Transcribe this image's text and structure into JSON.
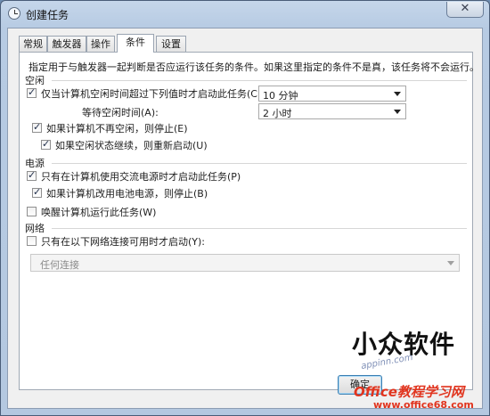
{
  "window": {
    "title": "创建任务",
    "close_glyph": "✕"
  },
  "tabs": [
    {
      "label": "常规",
      "active": false
    },
    {
      "label": "触发器",
      "active": false
    },
    {
      "label": "操作",
      "active": false
    },
    {
      "label": "条件",
      "active": true
    },
    {
      "label": "设置",
      "active": false
    }
  ],
  "conditions": {
    "description": "指定用于与触发器一起判断是否应运行该任务的条件。如果这里指定的条件不是真，该任务将不会运行。",
    "idle": {
      "heading": "空闲",
      "start_if_idle": {
        "label": "仅当计算机空闲时间超过下列值时才启动此任务(C):",
        "checked": true
      },
      "idle_duration": {
        "value": "10 分钟"
      },
      "wait_label": "等待空闲时间(A):",
      "wait_duration": {
        "value": "2 小时"
      },
      "stop_if_not_idle": {
        "label": "如果计算机不再空闲，则停止(E)",
        "checked": true
      },
      "restart_if_idle_resumes": {
        "label": "如果空闲状态继续，则重新启动(U)",
        "checked": true
      }
    },
    "power": {
      "heading": "电源",
      "ac_power": {
        "label": "只有在计算机使用交流电源时才启动此任务(P)",
        "checked": true
      },
      "stop_on_battery": {
        "label": "如果计算机改用电池电源，则停止(B)",
        "checked": true
      },
      "wake": {
        "label": "唤醒计算机运行此任务(W)",
        "checked": false
      }
    },
    "network": {
      "heading": "网络",
      "only_if_network": {
        "label": "只有在以下网络连接可用时才启动(Y):",
        "checked": false
      },
      "connection": {
        "value": "任何连接"
      }
    }
  },
  "buttons": {
    "ok_label": "确定"
  },
  "watermark": {
    "text": "小众软件",
    "tag": "appinn.com",
    "brand": "Office教程学习网",
    "brand_url": "www.office68.com"
  },
  "colors": {
    "brand_red": "#e1341e",
    "title_bar": "#b7cbe3"
  }
}
